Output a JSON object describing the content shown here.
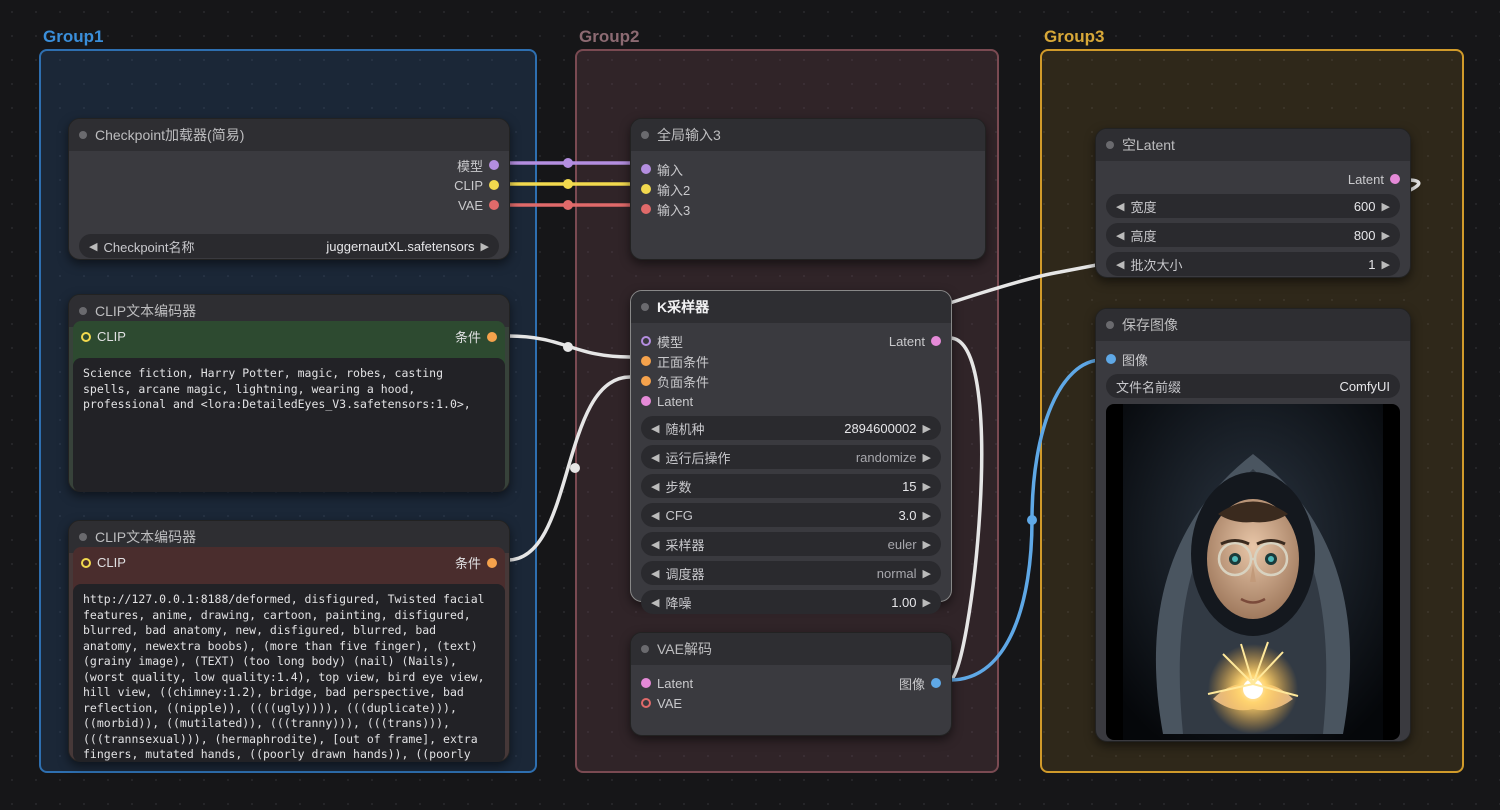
{
  "groups": {
    "g1": "Group1",
    "g2": "Group2",
    "g3": "Group3"
  },
  "ckpt": {
    "title": "Checkpoint加载器(简易)",
    "out_model": "模型",
    "out_clip": "CLIP",
    "out_vae": "VAE",
    "widget_label": "Checkpoint名称",
    "widget_value": "juggernautXL.safetensors"
  },
  "clip_pos": {
    "title": "CLIP文本编码器",
    "in": "CLIP",
    "out": "条件",
    "text": "Science fiction, Harry Potter, magic, robes, casting spells, arcane magic, lightning, wearing a hood, professional and <lora:DetailedEyes_V3.safetensors:1.0>,"
  },
  "clip_neg": {
    "title": "CLIP文本编码器",
    "in": "CLIP",
    "out": "条件",
    "text": "http://127.0.0.1:8188/deformed, disfigured, Twisted facial features, anime, drawing, cartoon, painting, disfigured, blurred, bad anatomy, new, disfigured, blurred, bad anatomy, newextra boobs), (more than five finger), (text) (grainy image), (TEXT) (too long body) (nail) (Nails), (worst quality, low quality:1.4), top view, bird eye view, hill view, ((chimney:1.2), bridge, bad perspective, bad reflection, ((nipple)), ((((ugly)))), (((duplicate))), ((morbid)), ((mutilated)), (((tranny))), (((trans))), (((trannsexual))), (hermaphrodite), [out of frame], extra fingers, mutated hands, ((poorly drawn hands)), ((poorly drawn face)), (((mutation))), (((deformed))), ((ugly)), blurry,"
  },
  "gin": {
    "title": "全局输入3",
    "in1": "输入",
    "in2": "输入2",
    "in3": "输入3"
  },
  "ks": {
    "title": "K采样器",
    "in_model": "模型",
    "in_pos": "正面条件",
    "in_neg": "负面条件",
    "in_latent": "Latent",
    "out_latent": "Latent",
    "seed_label": "随机种",
    "seed_val": "2894600002",
    "after_label": "运行后操作",
    "after_val": "randomize",
    "steps_label": "步数",
    "steps_val": "15",
    "cfg_label": "CFG",
    "cfg_val": "3.0",
    "sampler_label": "采样器",
    "sampler_val": "euler",
    "sched_label": "调度器",
    "sched_val": "normal",
    "denoise_label": "降噪",
    "denoise_val": "1.00"
  },
  "vae": {
    "title": "VAE解码",
    "in_latent": "Latent",
    "in_vae": "VAE",
    "out_image": "图像"
  },
  "lat": {
    "title": "空Latent",
    "out": "Latent",
    "w_label": "宽度",
    "w_val": "600",
    "h_label": "高度",
    "h_val": "800",
    "b_label": "批次大小",
    "b_val": "1"
  },
  "save": {
    "title": "保存图像",
    "in_image": "图像",
    "prefix_label": "文件名前缀",
    "prefix_val": "ComfyUI"
  }
}
